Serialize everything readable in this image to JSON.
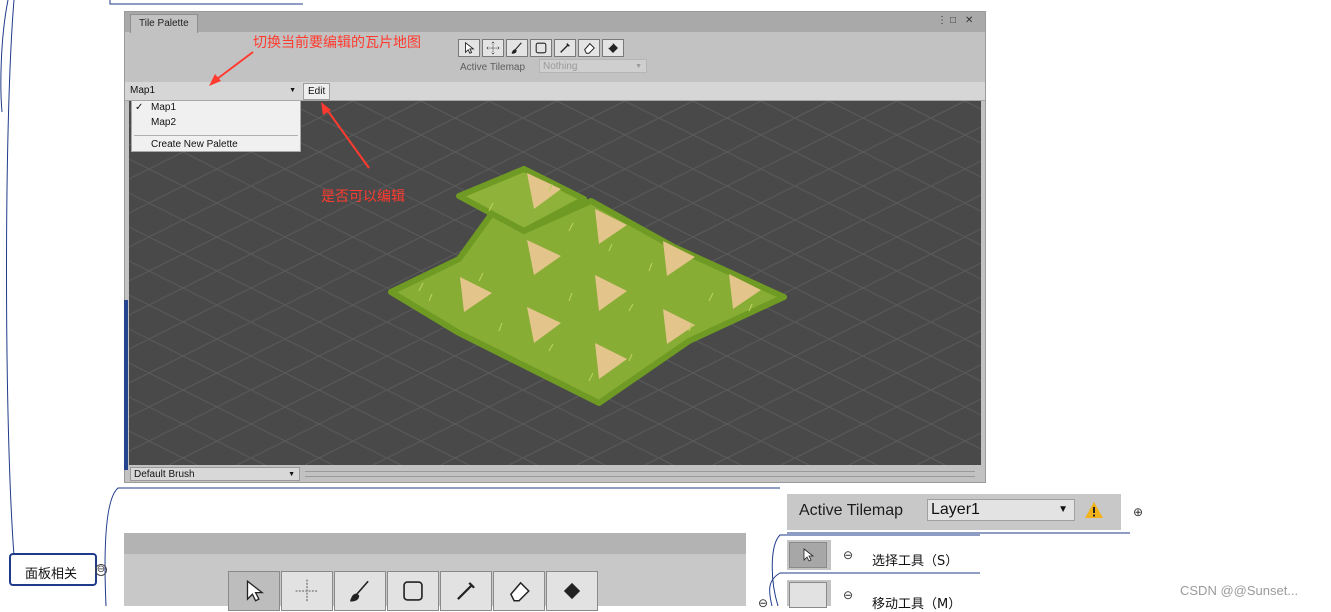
{
  "window": {
    "tab_title": "Tile Palette",
    "controls": {
      "menu": "⋮",
      "maximize": "□",
      "close": "✕"
    }
  },
  "toolbar": {
    "tools": [
      "select-tool",
      "move-tool",
      "paint-tool",
      "box-fill-tool",
      "picker-tool",
      "eraser-tool",
      "fill-tool"
    ],
    "active_tilemap_label": "Active Tilemap",
    "active_tilemap_value": "Nothing"
  },
  "palette_bar": {
    "selected_palette": "Map1",
    "edit_label": "Edit"
  },
  "palette_dropdown": {
    "items": [
      {
        "label": "Map1",
        "checked": "✓"
      },
      {
        "label": "Map2",
        "checked": ""
      }
    ],
    "create_label": "Create New Palette"
  },
  "bottom_bar": {
    "brush": "Default Brush"
  },
  "annotations": {
    "switch_palette": "切换当前要编辑的瓦片地图",
    "editable": "是否可以编辑"
  },
  "mindmap": {
    "node_label": "面板相关",
    "select_tool_label": "选择工具（S）",
    "move_tool_label": "移动工具（M）"
  },
  "big_active_tilemap": {
    "label": "Active Tilemap",
    "value": "Layer1"
  },
  "watermark": "CSDN @@Sunset...",
  "colors": {
    "annotation_red": "#ff3b2f",
    "mindmap_blue": "#1f3b8a",
    "canvas_bg": "#494949",
    "grass": "#8fb33a",
    "dirt": "#e3c48a"
  }
}
